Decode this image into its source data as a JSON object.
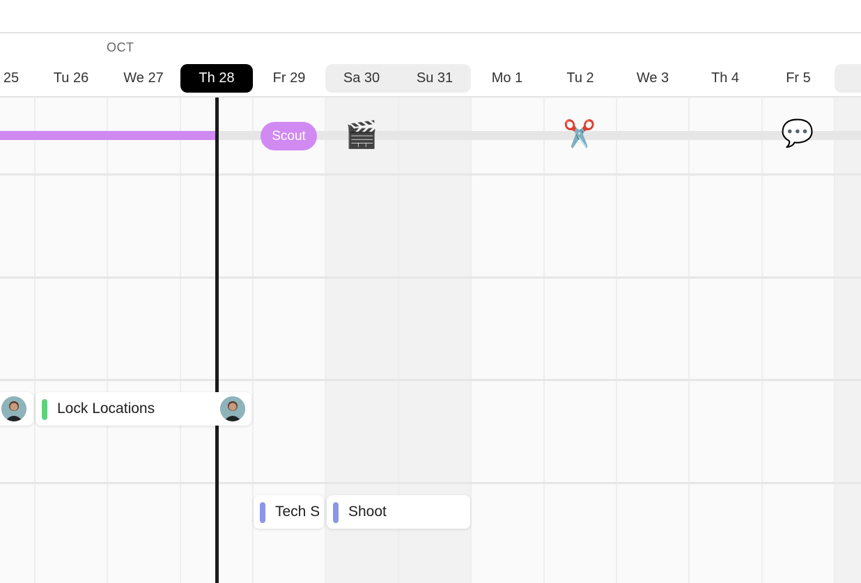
{
  "header": {
    "month": "OCT",
    "days": [
      "25",
      "Tu 26",
      "We 27",
      "Th 28",
      "Fr 29",
      "Sa 30",
      "Su 31",
      "Mo 1",
      "Tu 2",
      "We 3",
      "Th 4",
      "Fr 5"
    ],
    "today": "Th 28"
  },
  "milestones": {
    "scout_label": "Scout",
    "clapper_icon": "🎬",
    "scissors_icon": "✂️",
    "speech_icon": "💬"
  },
  "tasks": {
    "lock_locations": "Lock Locations",
    "tech_scout": "Tech Scout",
    "shoot": "Shoot"
  },
  "colors": {
    "today_bg": "#000000",
    "milestone_purple": "#d08af2",
    "task_green": "#5ed17d",
    "task_blue": "#8b96e6"
  }
}
